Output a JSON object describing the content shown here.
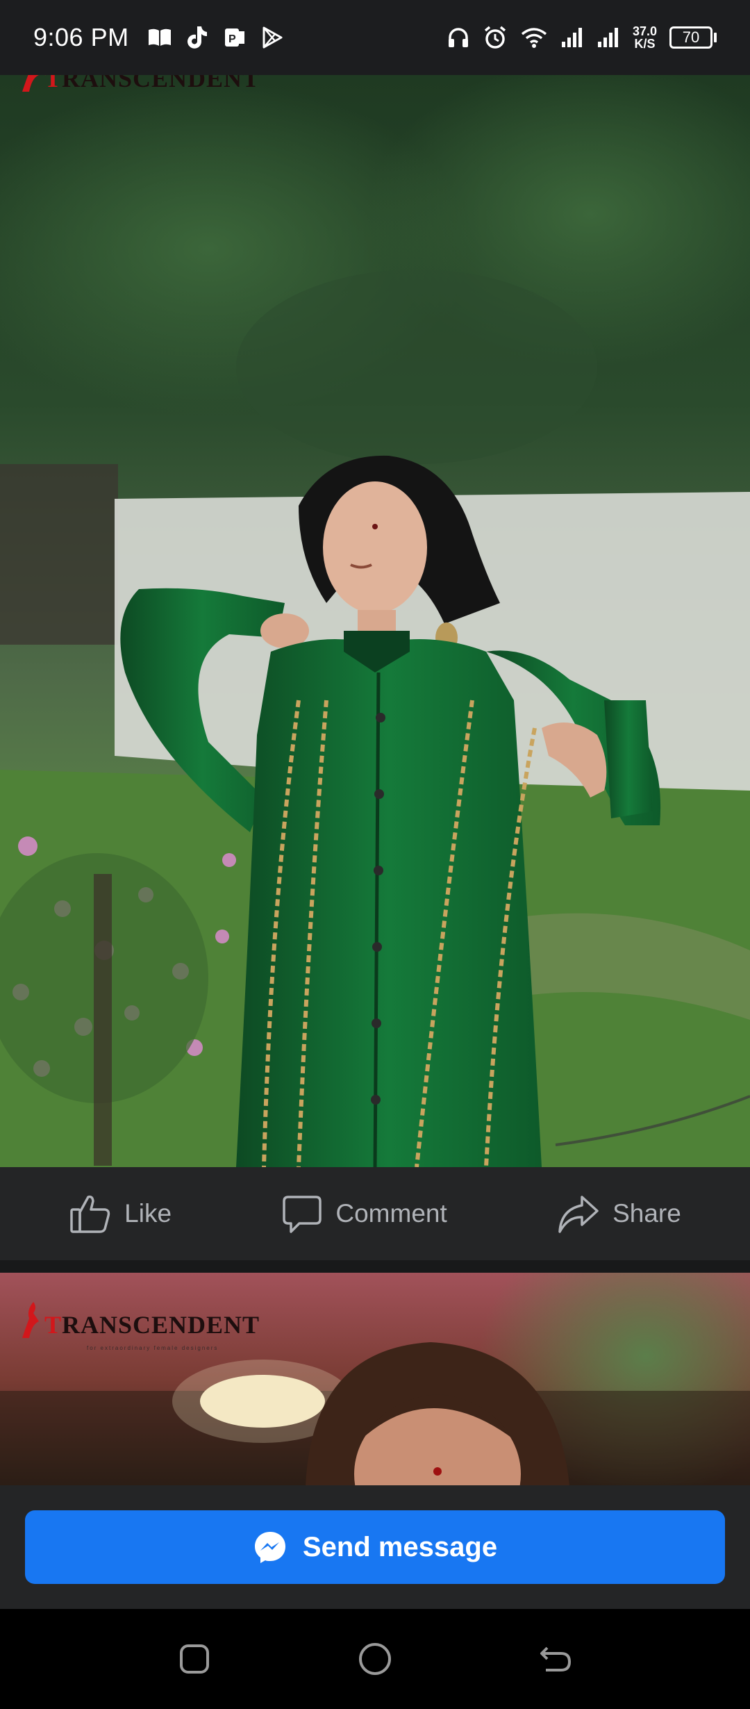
{
  "status_bar": {
    "time": "9:06 PM",
    "net_speed_value": "37.0",
    "net_speed_unit": "K/S",
    "battery_level": "70",
    "left_icons": [
      "book-icon",
      "tiktok-icon",
      "office-icon",
      "play-store-icon"
    ],
    "right_icons": [
      "headphones-icon",
      "alarm-icon",
      "wifi-icon",
      "signal-icon",
      "signal-icon"
    ]
  },
  "post_1": {
    "brand_text_prefix": "T",
    "brand_text_main": "RANSCENDENT"
  },
  "actions": {
    "like_label": "Like",
    "comment_label": "Comment",
    "share_label": "Share"
  },
  "post_2": {
    "brand_text_prefix": "T",
    "brand_text_red": "RANS",
    "brand_text_main": "CENDENT",
    "tagline": "for extraordinary female designers"
  },
  "send_message": {
    "label": "Send message",
    "icon": "messenger-icon"
  },
  "colors": {
    "primary_button": "#1877f2",
    "surface": "#242526",
    "text_secondary": "#b0b3b8",
    "brand_red": "#d2171b"
  },
  "navigation": {
    "icons": [
      "recent-apps-icon",
      "home-icon",
      "back-icon"
    ]
  }
}
